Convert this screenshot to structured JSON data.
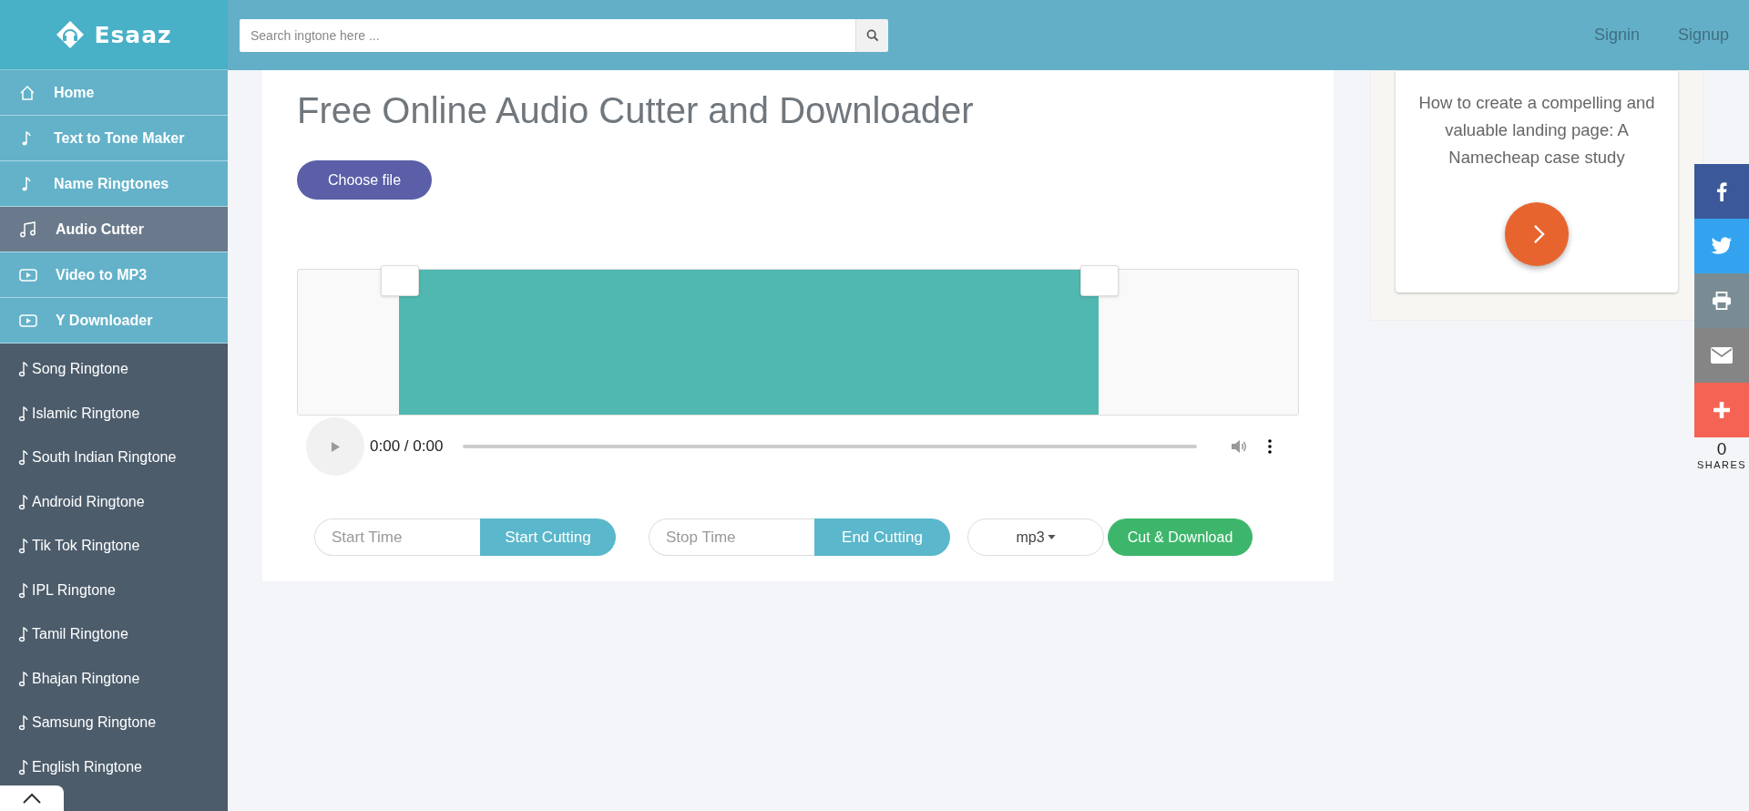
{
  "brand": {
    "name": "Esaaz"
  },
  "search": {
    "placeholder": "Search ingtone here ..."
  },
  "header_links": [
    "Signin",
    "Signup"
  ],
  "sidebar": {
    "menu": [
      {
        "label": "Home",
        "selected": false
      },
      {
        "label": "Text to Tone Maker",
        "selected": false
      },
      {
        "label": "Name Ringtones",
        "selected": false
      },
      {
        "label": "Audio Cutter",
        "selected": true
      },
      {
        "label": "Video to MP3",
        "selected": false
      },
      {
        "label": "Y Downloader",
        "selected": false
      }
    ],
    "categories": [
      "Song Ringtone",
      "Islamic Ringtone",
      "South Indian Ringtone",
      "Android Ringtone",
      "Tik Tok Ringtone",
      "IPL Ringtone",
      "Tamil Ringtone",
      "Bhajan Ringtone",
      "Samsung Ringtone",
      "English Ringtone"
    ]
  },
  "main": {
    "title": "Free Online Audio Cutter and Downloader",
    "choose_file": "Choose file",
    "player": {
      "time": "0:00 / 0:00"
    },
    "start": {
      "placeholder": "Start Time",
      "button": "Start Cutting"
    },
    "stop": {
      "placeholder": "Stop Time",
      "button": "End Cutting"
    },
    "format": "mp3",
    "download": "Cut & Download"
  },
  "ad": {
    "text": "How to create a compelling and valuable landing page: A Namecheap case study"
  },
  "share": {
    "count": "0",
    "label": "SHARES"
  }
}
